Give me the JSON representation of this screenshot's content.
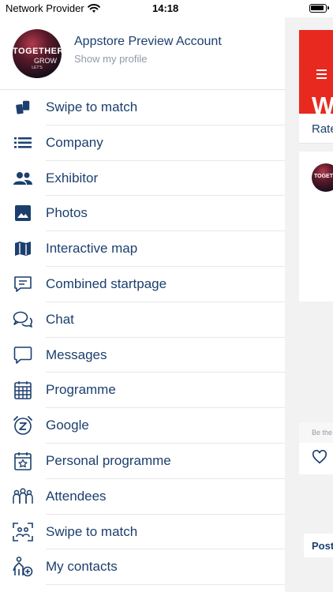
{
  "status_bar": {
    "carrier": "Network Provider",
    "time": "14:18"
  },
  "profile": {
    "name": "Appstore Preview Account",
    "subtitle": "Show my profile",
    "avatar_text": [
      "TOGETHER",
      "GROW",
      "LET'S"
    ]
  },
  "menu": [
    {
      "label": "Swipe to match",
      "icon": "swipe-cards-icon"
    },
    {
      "label": "Company",
      "icon": "list-icon"
    },
    {
      "label": "Exhibitor",
      "icon": "people-icon"
    },
    {
      "label": "Photos",
      "icon": "image-icon"
    },
    {
      "label": "Interactive map",
      "icon": "map-icon"
    },
    {
      "label": "Combined startpage",
      "icon": "message-square-icon"
    },
    {
      "label": "Chat",
      "icon": "chat-bubbles-icon"
    },
    {
      "label": "Messages",
      "icon": "message-bubble-icon"
    },
    {
      "label": "Programme",
      "icon": "calendar-grid-icon"
    },
    {
      "label": "Google",
      "icon": "alarm-clock-icon"
    },
    {
      "label": "Personal programme",
      "icon": "calendar-star-icon"
    },
    {
      "label": "Attendees",
      "icon": "group-icon"
    },
    {
      "label": "Swipe to match",
      "icon": "face-scan-icon"
    },
    {
      "label": "My contacts",
      "icon": "person-add-icon"
    }
  ],
  "background": {
    "header_letter": "W",
    "rate_text": "Rate",
    "be_the_text": "Be the",
    "post_button": "Post",
    "accent_color": "#e8291f",
    "text_color": "#1c3f6e"
  }
}
